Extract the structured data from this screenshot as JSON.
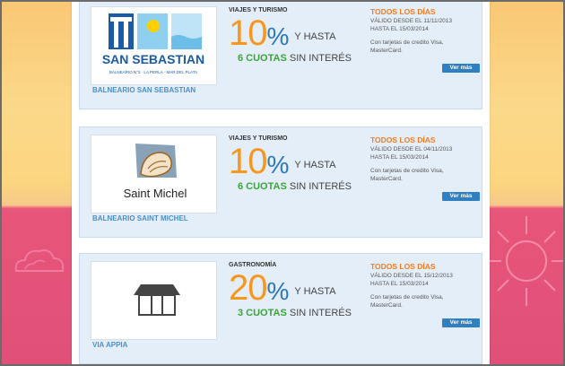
{
  "cards": [
    {
      "logo_text": "SAN SEBASTIAN",
      "logo_subtext": "BALNEARIO N°3 · LA PERLA · MAR DEL PLATA",
      "name": "BALNEARIO SAN SEBASTIAN",
      "category": "VIAJES Y TURISMO",
      "percent": "10",
      "percent_sign": "%",
      "up_to": "Y HASTA",
      "installments": "6 CUOTAS",
      "installments_suffix": "SIN INTERÉS",
      "days": "TODOS LOS DÍAS",
      "valid_from": "VÁLIDO DESDE EL 11/11/2013",
      "valid_to": "HASTA EL 15/03/2014",
      "cards_text": "Con tarjetas de credito Visa, MasterCard.",
      "button": "Ver más"
    },
    {
      "logo_text": "Saint Michel",
      "name": "BALNEARIO SAINT MICHEL",
      "category": "VIAJES Y TURISMO",
      "percent": "10",
      "percent_sign": "%",
      "up_to": "Y HASTA",
      "installments": "6 CUOTAS",
      "installments_suffix": "SIN INTERÉS",
      "days": "TODOS LOS DÍAS",
      "valid_from": "VÁLIDO DESDE EL 04/11/2013",
      "valid_to": "HASTA EL 15/03/2014",
      "cards_text": "Con tarjetas de credito Visa, MasterCard.",
      "button": "Ver más"
    },
    {
      "name": "VIA APPIA",
      "category": "GASTRONOMÍA",
      "percent": "20",
      "percent_sign": "%",
      "up_to": "Y HASTA",
      "installments": "3 CUOTAS",
      "installments_suffix": "SIN INTERÉS",
      "days": "TODOS LOS DÍAS",
      "valid_from": "VÁLIDO DESDE EL 15/12/2013",
      "valid_to": "HASTA EL 15/03/2014",
      "cards_text": "Con tarjetas de credito Visa, MasterCard.",
      "button": "Ver más"
    }
  ],
  "colors": {
    "accent_orange": "#f8971d",
    "accent_blue": "#2b78b8",
    "installments_green": "#3aa53a",
    "card_background": "#e4eef8"
  }
}
